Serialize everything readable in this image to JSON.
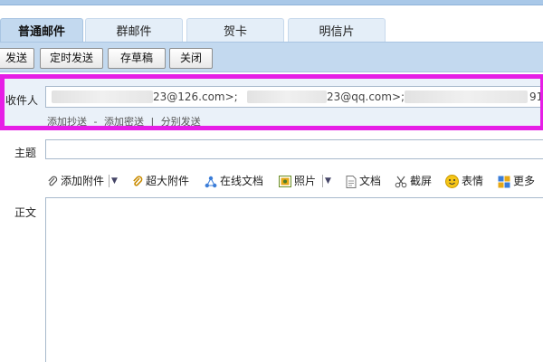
{
  "tabs": [
    "普通邮件",
    "群邮件",
    "贺卡",
    "明信片"
  ],
  "toolbar": {
    "send": "发送",
    "scheduled_send": "定时发送",
    "save_draft": "存草稿",
    "close": "关闭"
  },
  "recipients": {
    "label": "收件人",
    "chips": [
      "23@126.com>;",
      "23@qq.com>;",
      "91"
    ],
    "add_cc": "添加抄送",
    "add_bcc": "添加密送",
    "separator": "|",
    "separate_send": "分别发送"
  },
  "subject": {
    "label": "主题",
    "value": ""
  },
  "attachments": {
    "add_attachment": "添加附件",
    "large_attachment": "超大附件",
    "online_docs": "在线文档",
    "photos": "照片",
    "docs": "文档",
    "screenshot": "截屏",
    "emoji": "表情",
    "more": "更多"
  },
  "body": {
    "label": "正文",
    "value": ""
  },
  "colors": {
    "tab_active": "#c3d9ef",
    "toolbar_bg": "#c3d9ef",
    "highlight": "#e61ee6"
  }
}
